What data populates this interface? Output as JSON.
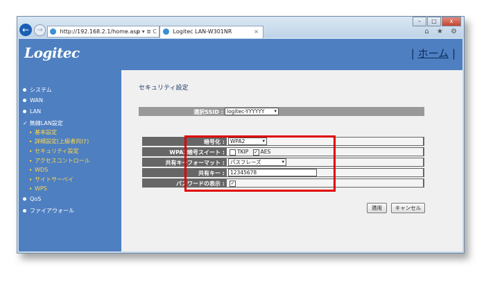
{
  "browser": {
    "back_glyph": "←",
    "forward_glyph": "→",
    "address": "http://192.168.2.1/home.asp",
    "address_tools": "ρ ▾ ≣ C",
    "tab_title": "Logitec LAN-W301NR",
    "tab_close": "×",
    "window_buttons": [
      "–",
      "□",
      "x"
    ],
    "toolbar_icons": "⌂ ★ ⚙"
  },
  "header": {
    "logo_text": "Logitec",
    "home_link_pipe_left": "|",
    "home_link": "ホーム",
    "home_link_pipe_right": "|"
  },
  "sidebar": {
    "items": [
      {
        "label": "システム"
      },
      {
        "label": "WAN"
      },
      {
        "label": "LAN"
      },
      {
        "label": "無線LAN設定"
      },
      {
        "label": "QoS"
      },
      {
        "label": "ファイアウォール"
      }
    ],
    "wireless_subitems": [
      {
        "label": "基本設定"
      },
      {
        "label": "詳細設定(上級者向け)"
      },
      {
        "label": "セキュリティ設定"
      },
      {
        "label": "アクセスコントロール"
      },
      {
        "label": "WDS"
      },
      {
        "label": "サイトサーベイ"
      },
      {
        "label": "WPS"
      }
    ],
    "check_glyph": "✓",
    "sub_glyph": "▸"
  },
  "content": {
    "title": "セキュリティ設定",
    "ssid_label": "選択SSID :",
    "ssid_value": "logitec-YYYYYY",
    "encryption_label": "暗号化 :",
    "encryption_value": "WPA2",
    "wpa2_suite_label": "WPA2暗号スイート :",
    "tkip_label": "TKIP",
    "tkip_checked": false,
    "aes_label": "AES",
    "aes_checked": true,
    "key_format_label": "共有キーフォーマット :",
    "key_format_value": "パスフレーズ",
    "shared_key_label": "共有キー :",
    "shared_key_value": "12345678",
    "show_password_label": "パスワードの表示 :",
    "show_password_checked": true,
    "apply_button": "適用",
    "cancel_button": "キャンセル",
    "select_arrow": "▾",
    "check_mark": "✓"
  },
  "colors": {
    "header_blue": "#4e7fc1",
    "sidebar_sub_yellow": "#ffd84a",
    "highlight_red": "#e00000",
    "row_dark": "#666666"
  }
}
